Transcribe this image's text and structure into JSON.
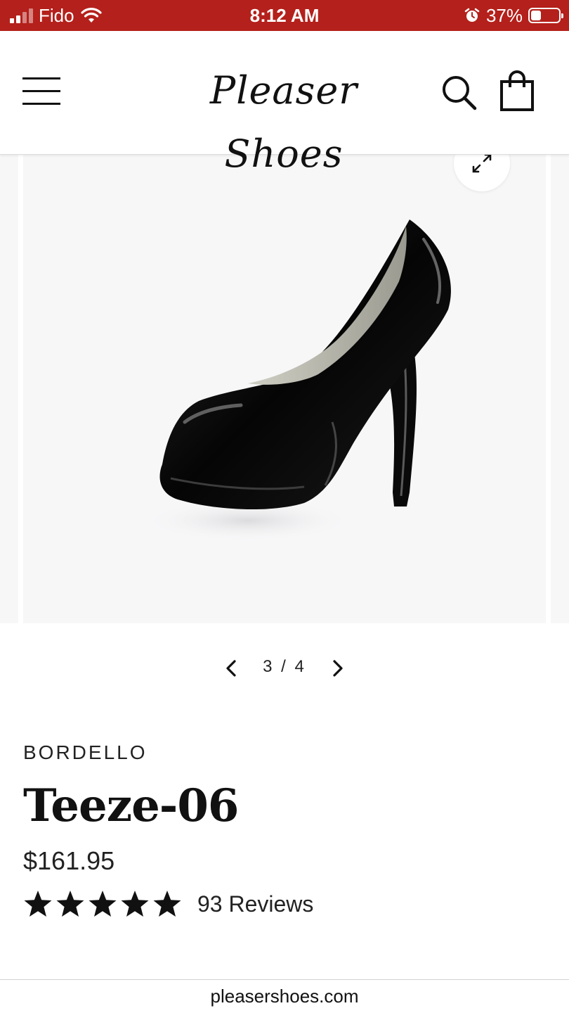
{
  "status_bar": {
    "carrier": "Fido",
    "time": "8:12 AM",
    "battery_percent": "37%",
    "battery_level": 0.37,
    "icons": [
      "signal-icon",
      "wifi-icon",
      "alarm-icon",
      "battery-icon"
    ],
    "background_color": "#b4201b"
  },
  "header": {
    "logo_text": "Pleaser Shoes",
    "icons": [
      "hamburger-menu-icon",
      "search-icon",
      "shopping-bag-icon"
    ]
  },
  "gallery": {
    "image_alt": "Black patent platform pump",
    "current": "3",
    "separator": "/",
    "total": "4",
    "icons": [
      "expand-icon",
      "chevron-left-icon",
      "chevron-right-icon"
    ]
  },
  "product": {
    "brand": "BORDELLO",
    "name": "Teeze-06",
    "price": "$161.95",
    "rating": 5,
    "rating_max": 5,
    "review_count": "93 Reviews"
  },
  "browser": {
    "url": "pleasershoes.com"
  }
}
